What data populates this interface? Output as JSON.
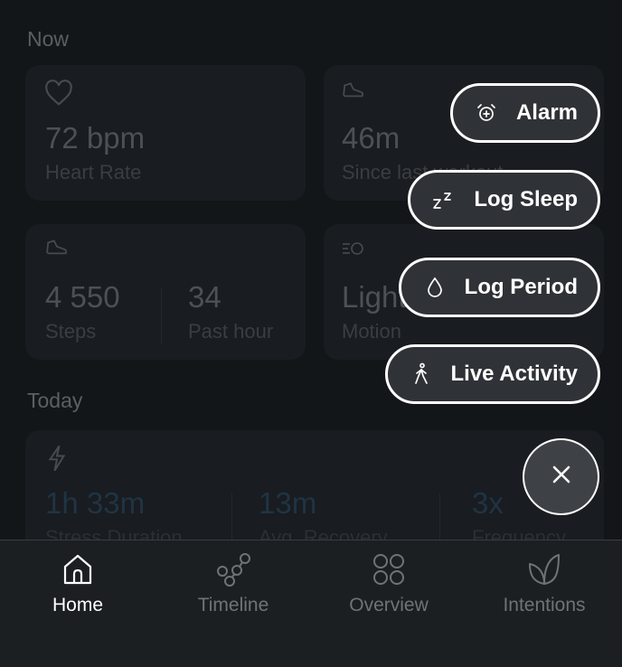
{
  "now": {
    "title": "Now",
    "heart_rate": {
      "value": "72 bpm",
      "label": "Heart Rate",
      "icon": "heart-icon"
    },
    "last_activity": {
      "value": "46m",
      "label": "Since last workout",
      "icon": "shoe-icon"
    },
    "steps": {
      "value": "4 550",
      "label": "Steps",
      "icon": "shoe-icon"
    },
    "past_hour": {
      "value": "34",
      "label": "Past hour"
    },
    "motion": {
      "value": "Light",
      "label": "Motion",
      "icon": "motion-icon"
    }
  },
  "today": {
    "title": "Today",
    "stress": [
      {
        "value": "1h 33m",
        "label": "Stress Duration"
      },
      {
        "value": "13m",
        "label": "Avg. Recovery"
      },
      {
        "value": "3x",
        "label": "Frequency"
      }
    ],
    "icon": "lightning-icon"
  },
  "fab_menu": {
    "items": [
      {
        "label": "Alarm",
        "icon": "alarm-clock-icon"
      },
      {
        "label": "Log Sleep",
        "icon": "zzz-icon"
      },
      {
        "label": "Log Period",
        "icon": "droplet-icon"
      },
      {
        "label": "Live Activity",
        "icon": "walking-icon"
      }
    ],
    "close_icon": "close-icon"
  },
  "tabbar": {
    "tabs": [
      {
        "label": "Home",
        "icon": "home-icon",
        "active": true
      },
      {
        "label": "Timeline",
        "icon": "timeline-icon",
        "active": false
      },
      {
        "label": "Overview",
        "icon": "grid-icon",
        "active": false
      },
      {
        "label": "Intentions",
        "icon": "leaf-icon",
        "active": false
      }
    ]
  },
  "colors": {
    "background": "#131619",
    "fab_pill": "#2f3236",
    "fab_border": "#ffffff",
    "tabbar": "#1c1f22",
    "active_tab": "#ffffff",
    "inactive_tab": "#6f7378"
  }
}
